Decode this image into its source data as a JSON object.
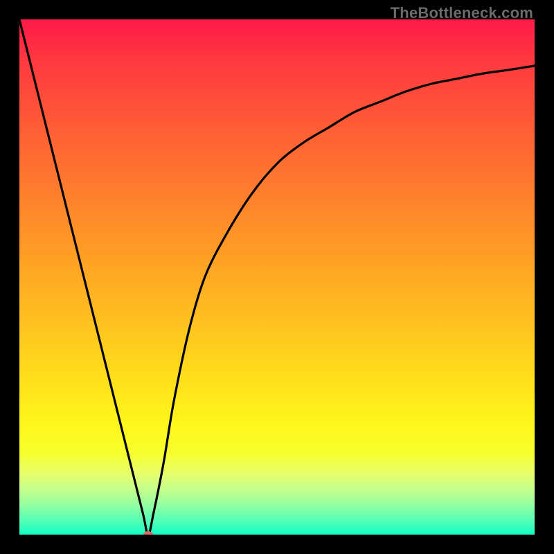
{
  "watermark": "TheBottleneck.com",
  "chart_data": {
    "type": "line",
    "title": "",
    "xlabel": "",
    "ylabel": "",
    "xlim": [
      0,
      100
    ],
    "ylim": [
      0,
      100
    ],
    "grid": false,
    "legend": false,
    "series": [
      {
        "name": "bottleneck-curve",
        "x": [
          0,
          5,
          10,
          15,
          20,
          22,
          24,
          25,
          26,
          28,
          30,
          33,
          36,
          40,
          45,
          50,
          55,
          60,
          65,
          70,
          75,
          80,
          85,
          90,
          95,
          100
        ],
        "values": [
          100,
          80,
          60,
          40,
          20,
          12,
          4,
          0,
          4,
          14,
          26,
          40,
          50,
          58,
          66,
          72,
          76,
          79,
          82,
          84,
          86,
          87.5,
          88.5,
          89.5,
          90.2,
          91
        ]
      }
    ],
    "marker": {
      "x": 25,
      "y": 0,
      "name": "minimum-point"
    },
    "background": {
      "type": "vertical-gradient",
      "stops": [
        {
          "pos": 0,
          "color": "#ff1a4a"
        },
        {
          "pos": 0.5,
          "color": "#ffba20"
        },
        {
          "pos": 0.8,
          "color": "#fff61a"
        },
        {
          "pos": 1.0,
          "color": "#14ffc4"
        }
      ]
    }
  }
}
